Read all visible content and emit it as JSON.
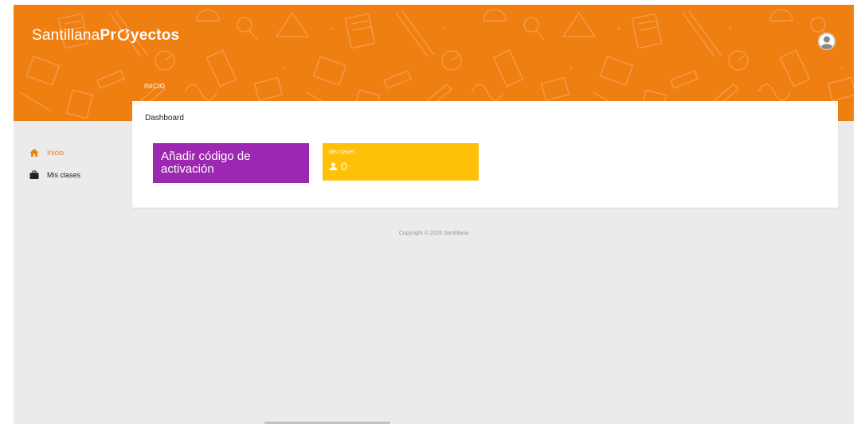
{
  "header": {
    "logo_light": "Santillana",
    "logo_bold_pre": "Pr",
    "logo_bold_post": "yectos",
    "breadcrumb": "INICIO"
  },
  "sidebar": {
    "items": [
      {
        "label": "Inicio",
        "icon": "home-icon",
        "active": true
      },
      {
        "label": "Mis clases",
        "icon": "briefcase-icon",
        "active": false
      }
    ]
  },
  "main": {
    "title": "Dashboard",
    "tiles": {
      "activation": {
        "label": "Añadir código de activación",
        "color": "#9c27b0"
      },
      "classes": {
        "label": "Mis clases",
        "value": "0",
        "icon": "person-icon",
        "color": "#fec107"
      }
    }
  },
  "footer": {
    "copyright": "Copyright © 2020 Santillana"
  },
  "colors": {
    "brand": "#f07f12",
    "background": "#ebebeb"
  }
}
